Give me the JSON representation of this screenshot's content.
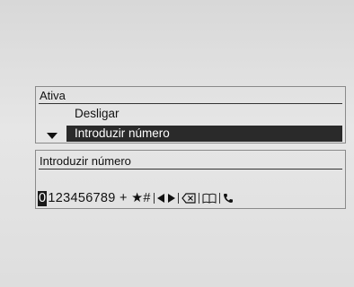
{
  "menu": {
    "title": "Ativa",
    "items": [
      {
        "label": "Desligar"
      },
      {
        "label": "Introduzir número",
        "selected": true
      }
    ]
  },
  "input": {
    "title": "Introduzir número",
    "cursor_char": "0",
    "chars": "123456789 + ★#",
    "icons": [
      "cursor-left-icon",
      "cursor-right-icon",
      "delete-icon",
      "phonebook-icon",
      "call-icon"
    ]
  },
  "colors": {
    "highlight_bg": "#2a2a2a",
    "highlight_text": "#ffffff",
    "background": "#e0e0e0"
  }
}
